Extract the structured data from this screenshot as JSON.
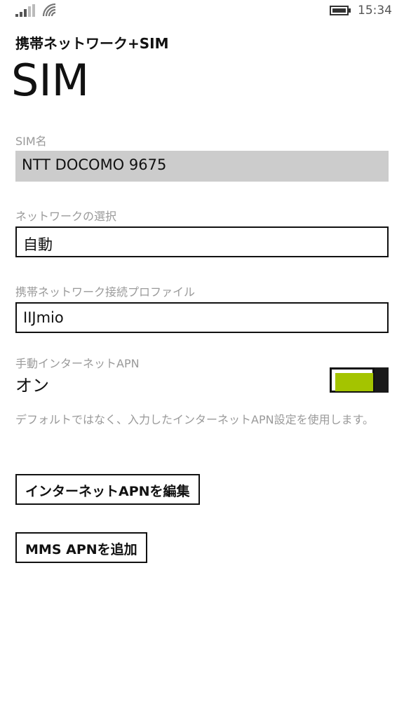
{
  "status_bar": {
    "time": "15:34",
    "signal_icon": "signal-bars-icon",
    "wifi_icon": "wifi-icon",
    "battery_icon": "battery-icon"
  },
  "header": {
    "app_title": "携帯ネットワーク+SIM",
    "page_title": "SIM"
  },
  "sim_name": {
    "label": "SIM名",
    "value": "NTT DOCOMO 9675"
  },
  "network_selection": {
    "label": "ネットワークの選択",
    "value": "自動"
  },
  "profile": {
    "label": "携帯ネットワーク接続プロファイル",
    "value": "IIJmio"
  },
  "manual_apn": {
    "label": "手動インターネットAPN",
    "state_text": "オン",
    "on": true,
    "accent_color": "#a4c400",
    "description": "デフォルトではなく、入力したインターネットAPN設定を使用します。"
  },
  "buttons": {
    "edit_apn": "インターネットAPNを編集",
    "add_mms_apn": "MMS APNを追加"
  }
}
